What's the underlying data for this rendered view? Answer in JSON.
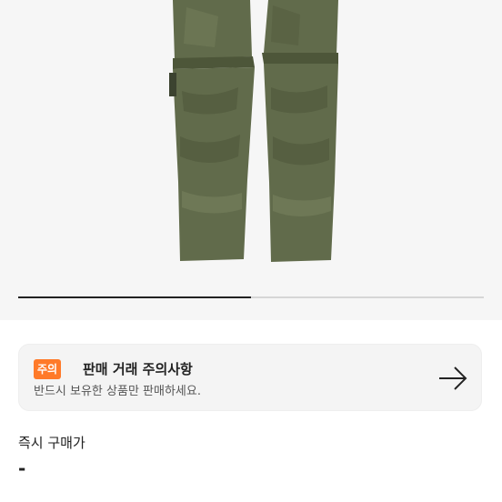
{
  "product_image": {
    "icon": "pants-image",
    "colors": {
      "pants": "#616b4b",
      "pants_shadow": "#4d5639",
      "pants_highlight": "#717b58",
      "background": "#f6f6f6"
    }
  },
  "gallery_progress": {
    "current_fraction": 0.5
  },
  "notice": {
    "badge": "주의",
    "title": "판매 거래 주의사항",
    "subtitle": "반드시 보유한 상품만 판매하세요.",
    "arrow_icon": "arrow-right-icon",
    "badge_color": "#ff7a29"
  },
  "instant_buy": {
    "label": "즉시 구매가",
    "value": "-"
  }
}
